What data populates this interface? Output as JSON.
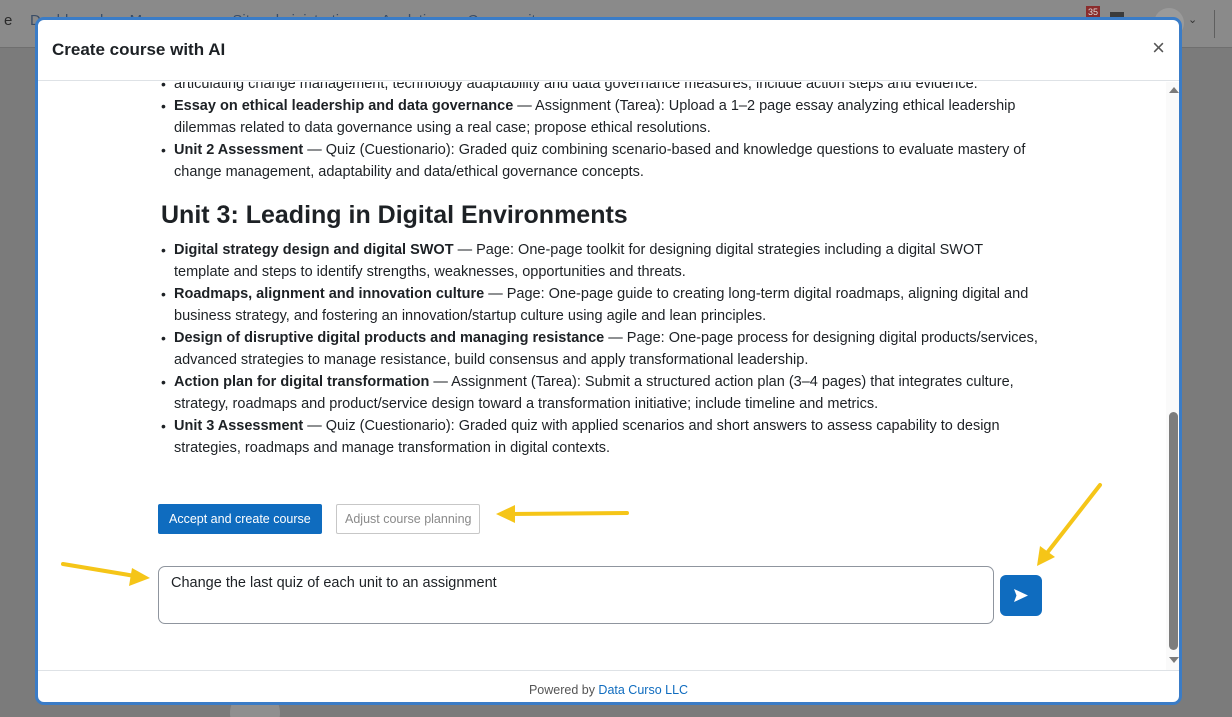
{
  "background": {
    "brand_fragment": "e",
    "nav_links": [
      "Dashboard",
      "My courses",
      "Site administration",
      "Analytics",
      "Community"
    ],
    "notification_count": "35"
  },
  "modal": {
    "title": "Create course with AI",
    "close_glyph": "×",
    "top_items": [
      {
        "lead": "",
        "text": "articulating change management, technology adaptability and data governance measures, include action steps and evidence."
      },
      {
        "lead": "Essay on ethical leadership and data governance",
        "text": " — Assignment (Tarea): Upload a 1–2 page essay analyzing ethical leadership dilemmas related to data governance using a real case; propose ethical resolutions."
      },
      {
        "lead": "Unit 2 Assessment",
        "text": " — Quiz (Cuestionario): Graded quiz combining scenario-based and knowledge questions to evaluate mastery of change management, adaptability and data/ethical governance concepts."
      }
    ],
    "unit3": {
      "heading": "Unit 3: Leading in Digital Environments",
      "items": [
        {
          "lead": "Digital strategy design and digital SWOT",
          "text": " — Page: One-page toolkit for designing digital strategies including a digital SWOT template and steps to identify strengths, weaknesses, opportunities and threats."
        },
        {
          "lead": "Roadmaps, alignment and innovation culture",
          "text": " — Page: One-page guide to creating long-term digital roadmaps, aligning digital and business strategy, and fostering an innovation/startup culture using agile and lean principles."
        },
        {
          "lead": "Design of disruptive digital products and managing resistance",
          "text": " — Page: One-page process for designing digital products/services, advanced strategies to manage resistance, build consensus and apply transformational leadership."
        },
        {
          "lead": "Action plan for digital transformation",
          "text": " — Assignment (Tarea): Submit a structured action plan (3–4 pages) that integrates culture, strategy, roadmaps and product/service design toward a transformation initiative; include timeline and metrics."
        },
        {
          "lead": "Unit 3 Assessment",
          "text": " — Quiz (Cuestionario): Graded quiz with applied scenarios and short answers to assess capability to design strategies, roadmaps and manage transformation in digital contexts."
        }
      ]
    },
    "buttons": {
      "accept": "Accept and create course",
      "adjust": "Adjust course planning"
    },
    "prompt": {
      "value": "Change the last quiz of each unit to an assignment"
    },
    "send_icon": "send-icon",
    "footer": {
      "prefix": "Powered by ",
      "link": "Data Curso LLC"
    }
  },
  "colors": {
    "primary": "#0f6cbf",
    "modal_border": "#3a7cc7",
    "annotation_arrow": "#f5c518"
  }
}
